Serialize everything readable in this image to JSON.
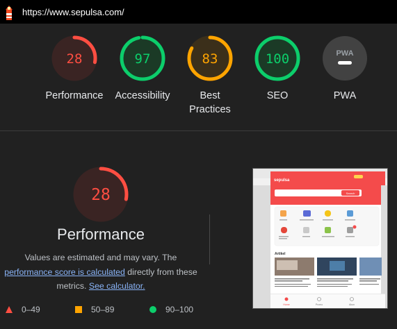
{
  "url_bar": {
    "url": "https://www.sepulsa.com/"
  },
  "gauges": [
    {
      "label": "Performance",
      "score": "28",
      "fraction": 0.28,
      "color": "#ff4e42",
      "bg": "#3a2423"
    },
    {
      "label": "Accessibility",
      "score": "97",
      "fraction": 0.97,
      "color": "#0cce6b",
      "bg": "#1b3a26"
    },
    {
      "label": "Best Practices",
      "score": "83",
      "fraction": 0.83,
      "color": "#ffa400",
      "bg": "#3b2f1a"
    },
    {
      "label": "SEO",
      "score": "100",
      "fraction": 1.0,
      "color": "#0cce6b",
      "bg": "#1b3a26"
    },
    {
      "label": "PWA",
      "badge": "PWA",
      "color": "#5f6368"
    }
  ],
  "performance": {
    "score": "28",
    "fraction": 0.28,
    "title": "Performance",
    "desc_1": "Values are estimated and may vary. The",
    "link_1": "performance score is calculated",
    "desc_2": "directly from these metrics.",
    "link_2": "See calculator."
  },
  "legend": [
    {
      "range": "0–49",
      "color": "#ff4e42",
      "shape": "triangle"
    },
    {
      "range": "50–89",
      "color": "#ffa400",
      "shape": "square"
    },
    {
      "range": "90–100",
      "color": "#0cce6b",
      "shape": "circle"
    }
  ],
  "screenshot": {
    "brand": "sepulsa",
    "search_button": "Search",
    "articles_heading": "Artikel",
    "nav": [
      "Home",
      "Promo",
      "Akun"
    ]
  }
}
